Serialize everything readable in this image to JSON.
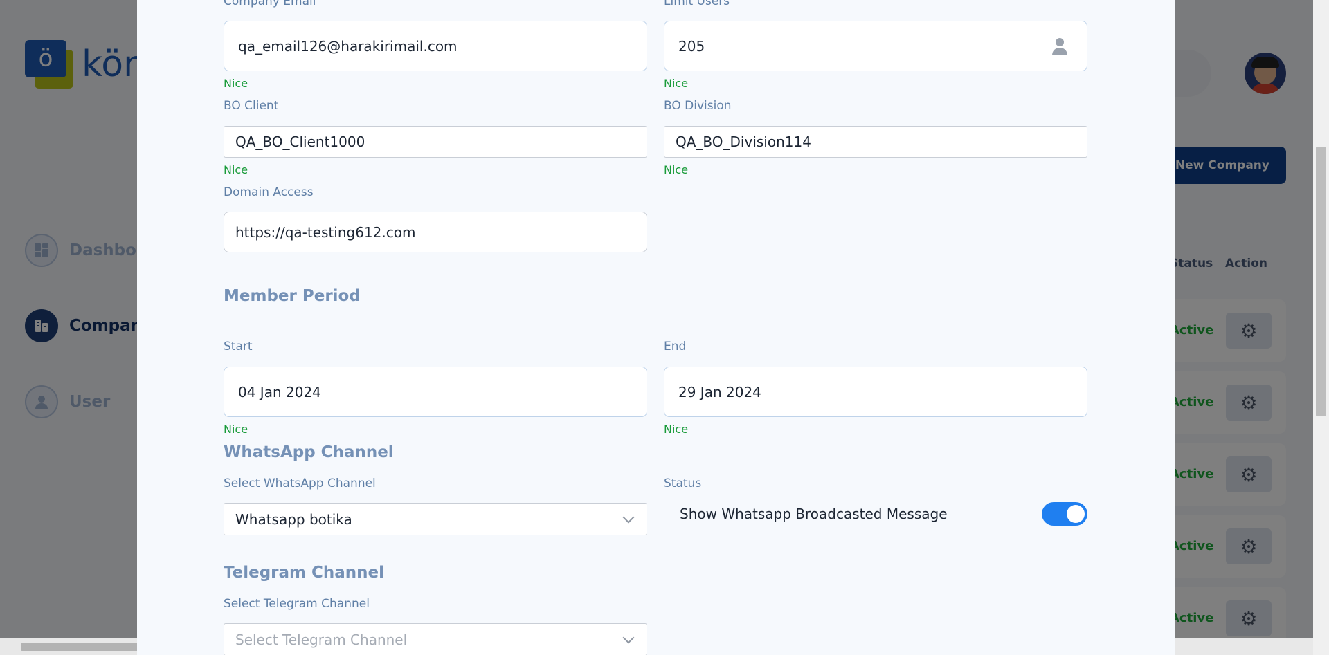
{
  "background": {
    "logo": {
      "mark": "ö",
      "text": "kön"
    },
    "sidebar": {
      "items": [
        {
          "label": "Dashboard",
          "icon": "dashboard-icon",
          "active": false
        },
        {
          "label": "Company",
          "icon": "company-icon",
          "active": true
        },
        {
          "label": "User",
          "icon": "user-icon",
          "active": false
        }
      ]
    },
    "new_company_button": "+ New Company",
    "table": {
      "headers": {
        "status": "Status",
        "action": "Action"
      },
      "rows": [
        {
          "status": "Active"
        },
        {
          "status": "Active"
        },
        {
          "status": "Active"
        },
        {
          "status": "Active"
        },
        {
          "status": "Active"
        }
      ]
    }
  },
  "modal": {
    "company_email": {
      "label": "Company Email",
      "value": "qa_email126@harakirimail.com",
      "validation": "Nice"
    },
    "limit_users": {
      "label": "Limit Users",
      "value": "205",
      "validation": "Nice",
      "icon": "person-icon"
    },
    "bo_client": {
      "label": "BO Client",
      "value": "QA_BO_Client1000",
      "validation": "Nice"
    },
    "bo_division": {
      "label": "BO Division",
      "value": "QA_BO_Division114",
      "validation": "Nice"
    },
    "domain_access": {
      "label": "Domain Access",
      "value": "https://qa-testing612.com"
    },
    "member_period": {
      "title": "Member Period",
      "start": {
        "label": "Start",
        "value": "04 Jan 2024",
        "validation": "Nice"
      },
      "end": {
        "label": "End",
        "value": "29 Jan 2024",
        "validation": "Nice"
      }
    },
    "whatsapp": {
      "title": "WhatsApp Channel",
      "select_label": "Select WhatsApp Channel",
      "selected": "Whatsapp botika",
      "status_label": "Status",
      "toggle_label": "Show Whatsapp Broadcasted Message",
      "toggle_on": true
    },
    "telegram": {
      "title": "Telegram Channel",
      "select_label": "Select Telegram Channel",
      "placeholder": "Select Telegram Channel"
    }
  },
  "colors": {
    "accent": "#1f7ff0",
    "validation_green": "#1a9b3a",
    "label_blue": "#5f7fa6",
    "brand_dark": "#0f3e8b"
  }
}
